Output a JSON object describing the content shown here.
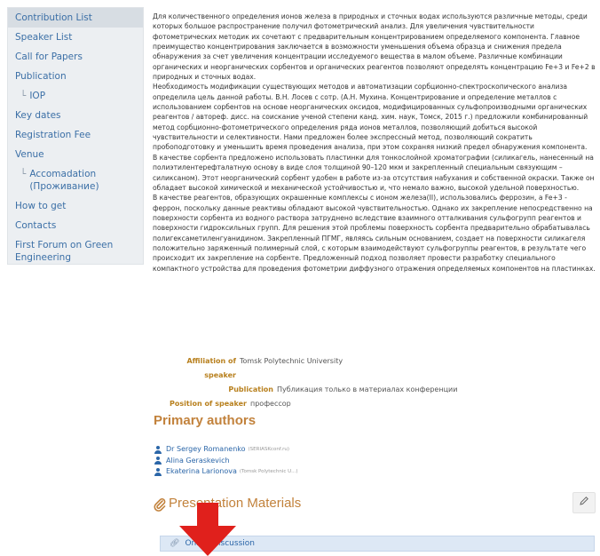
{
  "sidebar": {
    "items": [
      {
        "label": "Contribution List",
        "active": true
      },
      {
        "label": "Speaker List"
      },
      {
        "label": "Call for Papers"
      },
      {
        "label": "Publication"
      },
      {
        "label": "IOP",
        "sub": true
      },
      {
        "label": "Key dates"
      },
      {
        "label": "Registration Fee"
      },
      {
        "label": "Venue"
      },
      {
        "label": "Accomadation (Проживание)",
        "sub": true
      },
      {
        "label": "How to get"
      },
      {
        "label": "Contacts"
      },
      {
        "label": "First Forum on Green Engineering"
      }
    ]
  },
  "abstract": {
    "paragraphs": [
      "Для количественного определения ионов железа в природных и сточных водах используются различные методы, среди которых большое распространение получил фотометрический анализ. Для увеличения чувствительности фотометрических методик их сочетают с предварительным концентрированием определяемого компонента. Главное преимущество концентрирования заключается в возможности уменьшения объема образца и снижения предела обнаружения за счет увеличения концентрации исследуемого вещества в малом объеме. Различные комбинации органических и неорганических сорбентов и органических реагентов позволяют определять концентрацию Fe+3 и Fe+2 в природных и сточных водах.",
      "Необходимость модификации существующих методов и автоматизации сорбционно-спектроскопического анализа определила цель данной работы. В.Н. Лосев с сотр. (А.Н. Мухина. Концентрирование и определение металлов с использованием сорбентов на основе неорганических оксидов, модифицированных сульфопроизводными органических реагентов / автореф. дисс. на соискание ученой степени канд. хим. наук, Томск, 2015 г.) предложили комбинированный метод сорбционно-фотометрического определения ряда ионов металлов, позволяющий добиться высокой чувствительности и селективности. Нами предложен более экспрессный метод, позволяющий сократить пробоподготовку и уменьшить время проведения анализа, при этом сохраняя низкий предел обнаружения компонента.",
      "В качестве сорбента предложено использовать пластинки для тонкослойной хроматографии (силикагель, нанесенный на полиэтилентерефталатную основу в виде слоя толщиной 90–120 мкм и закрепленный специальным связующим – силиксаном). Этот неорганический сорбент удобен в работе из-за отсутствия набухания и собственной окраски. Также он обладает высокой химической и механической устойчивостью и, что немало важно, высокой удельной поверхностью.",
      "В качестве реагентов, образующих окрашенные комплексы с ионом железа(II), использовались феррозин, а Fe+3 - феррон, поскольку данные реактивы обладают высокой чувствительностью. Однако их закрепление непосредственно на поверхности сорбента из водного раствора затруднено вследствие взаимного отталкивания сульфогрупп реагентов и поверхности гидроксильных групп. Для решения этой проблемы поверхность сорбента предварительно обрабатывалась полигексаметиленгуанидином. Закрепленный ПГМГ, являясь сильным основанием, создает на поверхности силикагеля положительно заряженный полимерный слой, с которым взаимодействуют сульфогруппы реагентов, в результате чего происходит их закрепление на сорбенте. Предложенный подход позволяет провести разработку специального компактного устройства для проведения фотометрии диффузного отражения определяемых компонентов на пластинках."
    ]
  },
  "fields": {
    "affiliation_label": "Affiliation of speaker",
    "affiliation_value": "Tomsk Polytechnic University",
    "publication_label": "Publication",
    "publication_value": "Публикация только в материалах конференции",
    "position_label": "Position of speaker",
    "position_value": "профессор"
  },
  "authors": {
    "title": "Primary authors",
    "list": [
      {
        "name": "Dr Sergey Romanenko",
        "affiliation": "(SERIASKconf.ru)"
      },
      {
        "name": "Alina Geraskevich",
        "affiliation": ""
      },
      {
        "name": "Ekaterina Larionova",
        "affiliation": "(Tomsk Polytechnic U...)"
      }
    ]
  },
  "materials": {
    "title": "Presentation Materials",
    "online_discussion": "Online discussion"
  },
  "colors": {
    "link": "#3b6fa6",
    "section": "#c2823c",
    "field_label": "#b8801e",
    "arrow": "#e0201c"
  },
  "icons": [
    "person-icon",
    "paperclip-icon",
    "pencil-icon",
    "link-icon",
    "arrow-down-icon"
  ]
}
